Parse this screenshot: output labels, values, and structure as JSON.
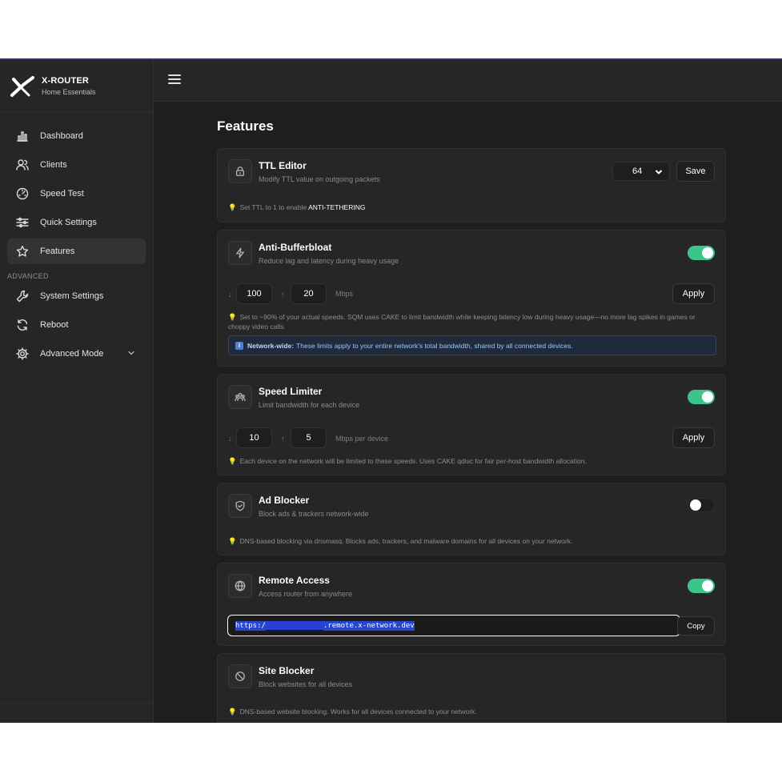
{
  "brand": {
    "name": "X-ROUTER",
    "subtitle": "Home Essentials"
  },
  "sidebar": {
    "items": [
      {
        "label": "Dashboard",
        "icon": "bar-chart-icon"
      },
      {
        "label": "Clients",
        "icon": "users-icon"
      },
      {
        "label": "Speed Test",
        "icon": "gauge-icon"
      },
      {
        "label": "Quick Settings",
        "icon": "sliders-icon"
      },
      {
        "label": "Features",
        "icon": "star-icon",
        "active": true
      }
    ],
    "section_label": "ADVANCED",
    "advanced_items": [
      {
        "label": "System Settings",
        "icon": "wrench-icon"
      },
      {
        "label": "Reboot",
        "icon": "refresh-icon"
      },
      {
        "label": "Advanced Mode",
        "icon": "gear-icon"
      }
    ]
  },
  "page": {
    "title": "Features"
  },
  "features": {
    "ttl": {
      "title": "TTL Editor",
      "subtitle": "Modify TTL value on outgoing packets",
      "selected_value": "64",
      "save_label": "Save",
      "hint_prefix": "Set TTL to 1 to enable",
      "hint_highlight": "ANTI-TETHERING"
    },
    "bufferbloat": {
      "title": "Anti-Bufferbloat",
      "subtitle": "Reduce lag and latency during heavy usage",
      "enabled": true,
      "down_arrow": "↓",
      "down_value": "100",
      "up_arrow": "↑",
      "up_value": "20",
      "unit": "Mbps",
      "apply_label": "Apply",
      "hint": "Set to ~90% of your actual speeds. SQM uses CAKE to limit bandwidth while keeping latency low during heavy usage—no more lag spikes in games or choppy video calls.",
      "info_icon": "i",
      "info_strong": "Network-wide:",
      "info_text": "These limits apply to your entire network's total bandwidth, shared by all connected devices."
    },
    "speed_limiter": {
      "title": "Speed Limiter",
      "subtitle": "Limit bandwidth for each device",
      "enabled": true,
      "down_arrow": "↓",
      "down_value": "10",
      "up_arrow": "↑",
      "up_value": "5",
      "unit": "Mbps per device",
      "apply_label": "Apply",
      "hint": "Each device on the network will be limited to these speeds. Uses CAKE qdisc for fair per-host bandwidth allocation."
    },
    "ad_blocker": {
      "title": "Ad Blocker",
      "subtitle": "Block ads & trackers network-wide",
      "enabled": false,
      "hint": "DNS-based blocking via dnsmasq. Blocks ads, trackers, and malware domains for all devices on your network."
    },
    "remote_access": {
      "title": "Remote Access",
      "subtitle": "Access router from anywhere",
      "enabled": true,
      "url_prefix": "https:/",
      "url_suffix": ".remote.x-network.dev",
      "copy_label": "Copy"
    },
    "site_blocker": {
      "title": "Site Blocker",
      "subtitle": "Block websites for all devices",
      "hint": "DNS-based website blocking. Works for all devices connected to your network."
    }
  },
  "colors": {
    "toggle_on": "#3cc48a",
    "accent_border": "#3a2d6b",
    "info_bg": "#1f2a3c"
  }
}
